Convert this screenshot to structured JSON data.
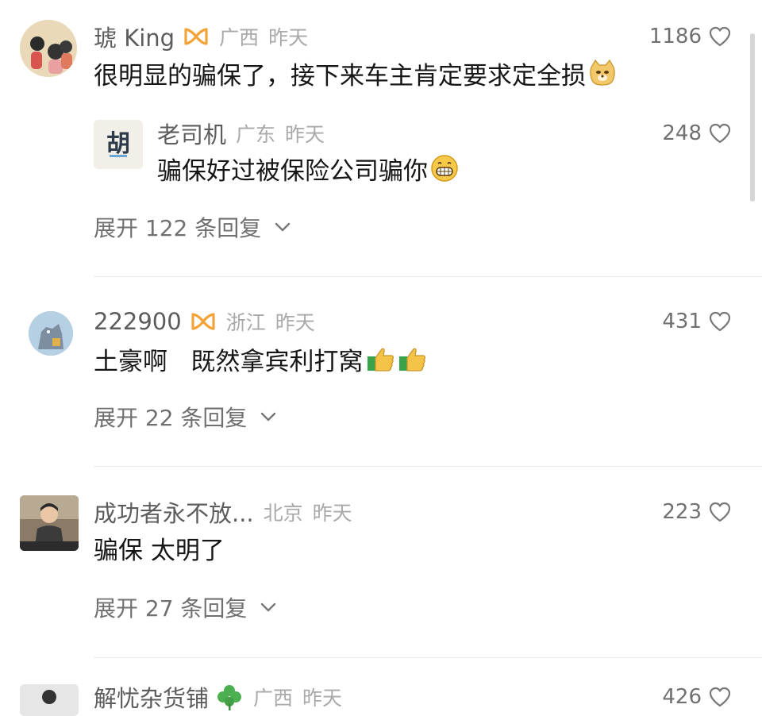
{
  "comments": [
    {
      "username": "琥 King",
      "location": "广西",
      "time": "昨天",
      "likes": "1186",
      "text": "很明显的骗保了，接下来车主肯定要求定全损",
      "emoji": "doge-emoji",
      "badge": "vip-badge",
      "reply": {
        "username": "老司机",
        "location": "广东",
        "time": "昨天",
        "likes": "248",
        "text": "骗保好过被保险公司骗你",
        "emoji": "grin-emoji",
        "avatar_text": "胡"
      },
      "expand_label": "展开 122 条回复"
    },
    {
      "username": "222900",
      "location": "浙江",
      "time": "昨天",
      "likes": "431",
      "text": "土豪啊   既然拿宾利打窝",
      "emoji": "thumbs-up-emoji",
      "badge": "vip-badge",
      "expand_label": "展开 22 条回复"
    },
    {
      "username": "成功者永不放...",
      "location": "北京",
      "time": "昨天",
      "likes": "223",
      "text": "骗保 太明了",
      "expand_label": "展开 27 条回复"
    },
    {
      "username": "解忧杂货铺",
      "location": "广西",
      "time": "昨天",
      "likes": "426",
      "badge": "clover-badge"
    }
  ],
  "colors": {
    "username": "#5c5c5c",
    "meta": "#a9a9a9",
    "text": "#161616",
    "secondary": "#707070",
    "badge_orange": "#f2a33a"
  }
}
